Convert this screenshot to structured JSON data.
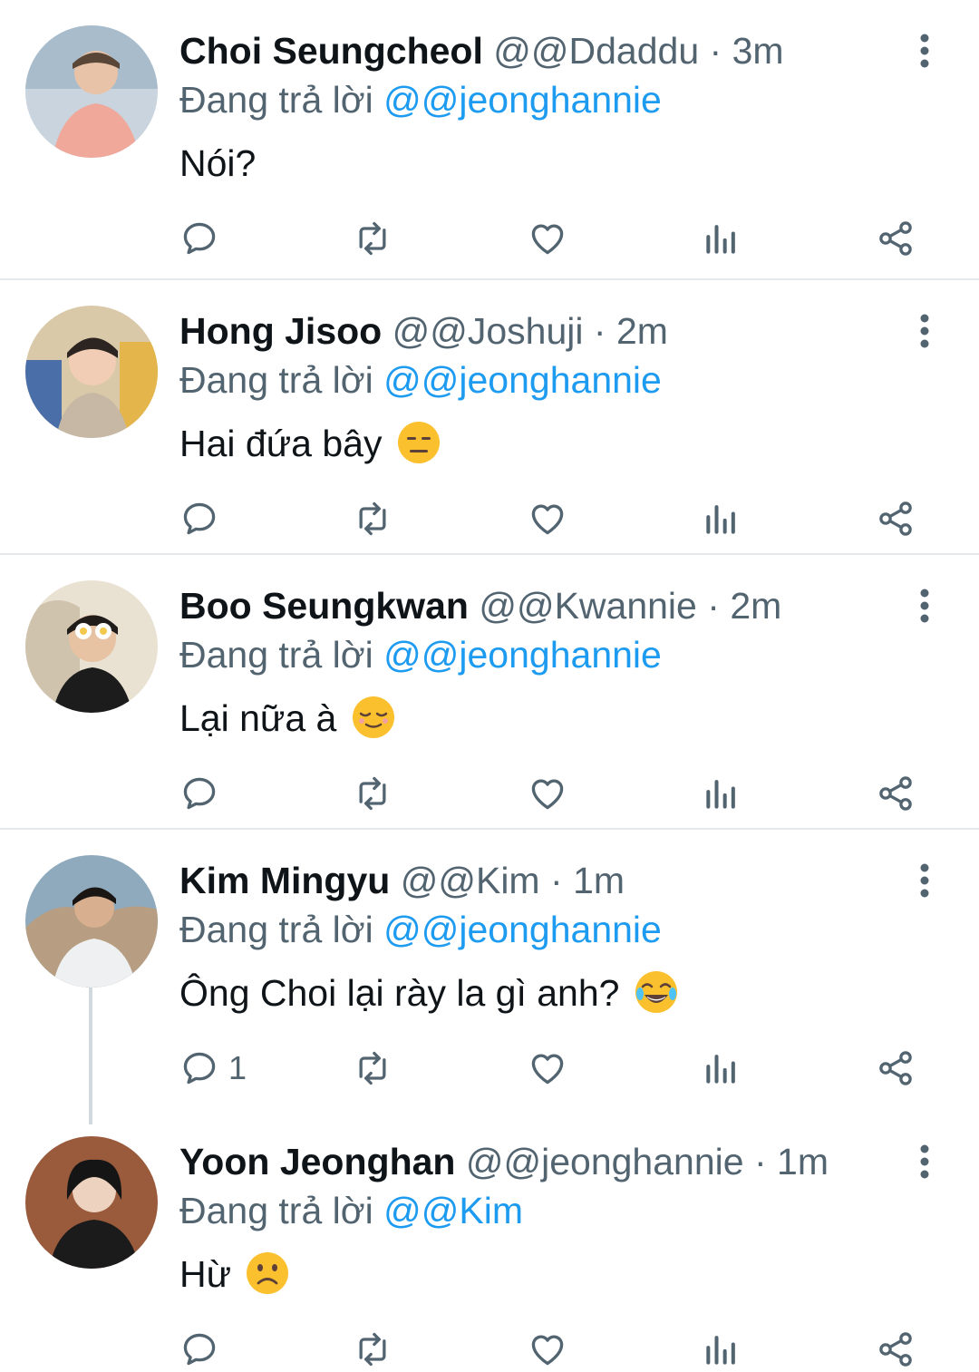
{
  "replying_label": "Đang trả lời",
  "tweets": [
    {
      "name": "Choi Seungcheol",
      "handle": "@@Ddaddu",
      "dot": "·",
      "time": "3m",
      "reply_to": "@@jeonghannie",
      "text": "Nói?",
      "emoji": "",
      "reply_count": ""
    },
    {
      "name": "Hong Jisoo",
      "handle": "@@Joshuji",
      "dot": "·",
      "time": "2m",
      "reply_to": "@@jeonghannie",
      "text": "Hai đứa bây",
      "emoji": "expressionless-face-emoji",
      "reply_count": ""
    },
    {
      "name": "Boo Seungkwan",
      "handle": "@@Kwannie",
      "dot": "·",
      "time": "2m",
      "reply_to": "@@jeonghannie",
      "text": "Lại nữa à",
      "emoji": "relieved-face-emoji",
      "reply_count": ""
    },
    {
      "name": "Kim Mingyu",
      "handle": "@@Kim",
      "dot": "·",
      "time": "1m",
      "reply_to": "@@jeonghannie",
      "text": "Ông Choi lại rày la gì anh?",
      "emoji": "tears-of-joy-emoji",
      "reply_count": "1"
    },
    {
      "name": "Yoon Jeonghan",
      "handle": "@@jeonghannie",
      "dot": "·",
      "time": "1m",
      "reply_to": "@@Kim",
      "text": "Hừ",
      "emoji": "frowning-face-emoji",
      "reply_count": ""
    }
  ],
  "colors": {
    "accent": "#1d9bf0",
    "muted": "#536471",
    "text": "#0f1419",
    "divider": "#e6e9ec",
    "emoji": "#fbc02d"
  }
}
